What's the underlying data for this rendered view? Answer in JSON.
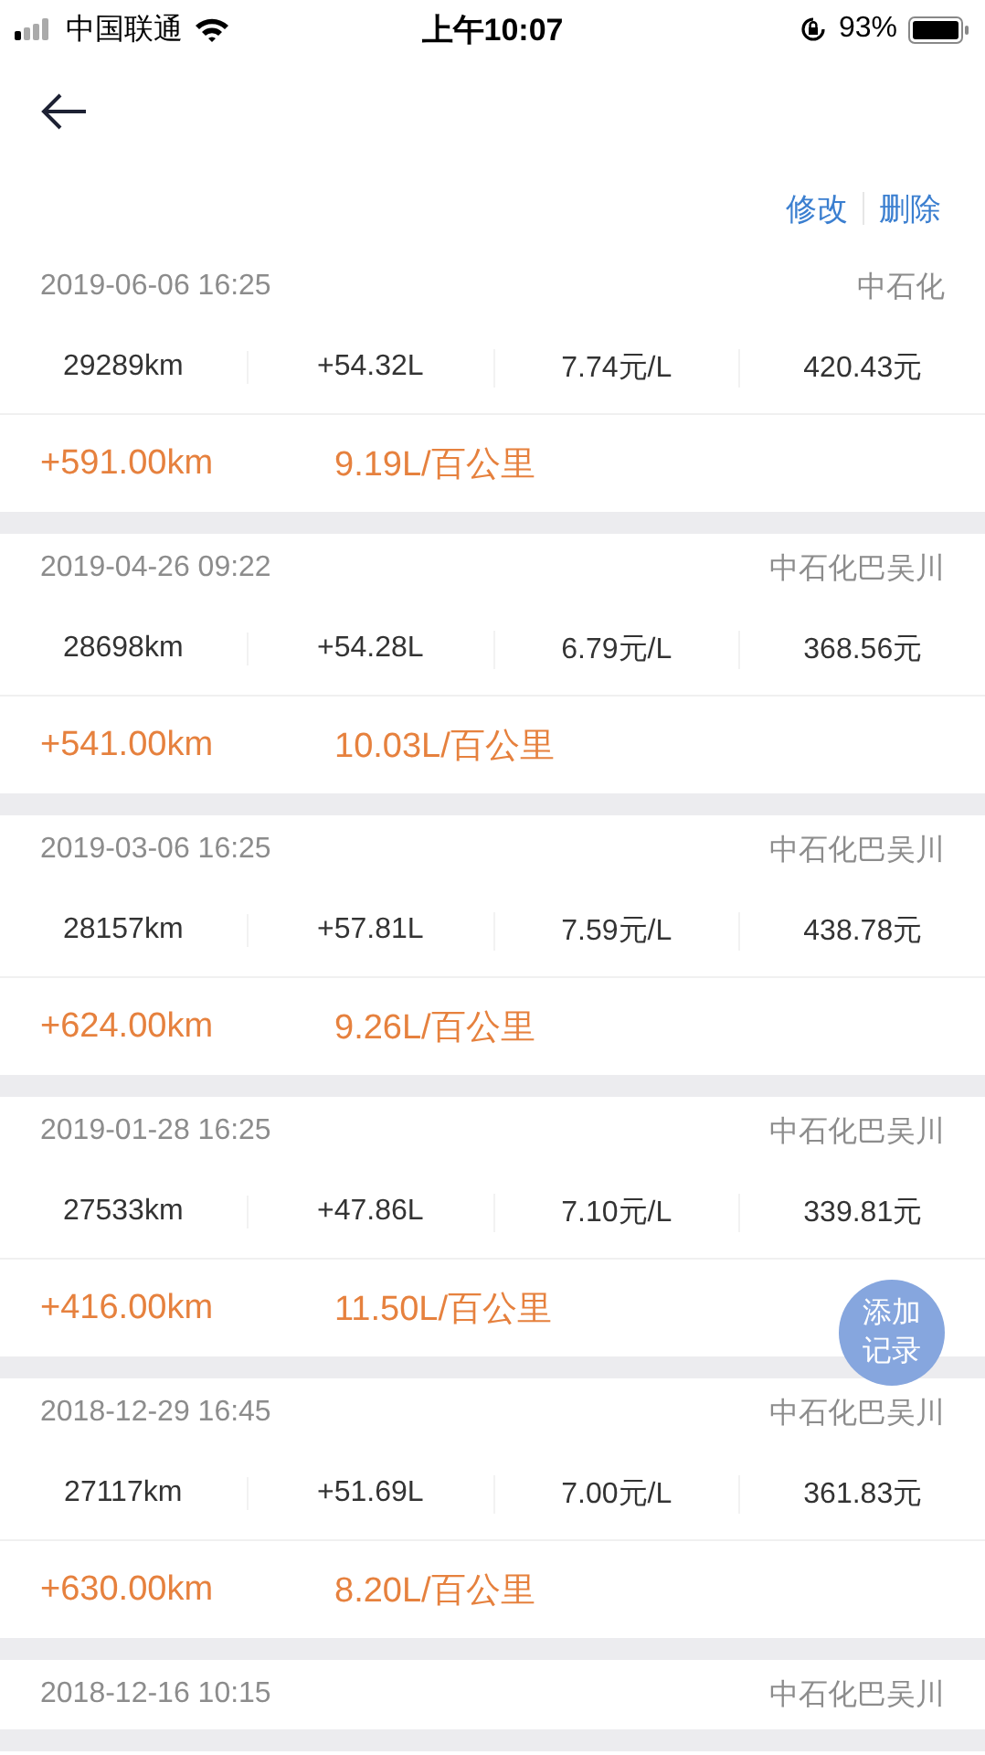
{
  "status_bar": {
    "carrier": "中国联通",
    "time": "上午10:07",
    "battery": "93%"
  },
  "actions": [
    "修改",
    "删除"
  ],
  "records": [
    {
      "date": "2019-06-06 16:25",
      "station": "中石化",
      "values": [
        "29289km",
        "+54.32L",
        "7.74元/L",
        "420.43元"
      ],
      "distance": "+591.00km",
      "consumption": "9.19L/百公里"
    },
    {
      "date": "2019-04-26 09:22",
      "station": "中石化巴吴川",
      "values": [
        "28698km",
        "+54.28L",
        "6.79元/L",
        "368.56元"
      ],
      "distance": "+541.00km",
      "consumption": "10.03L/百公里"
    },
    {
      "date": "2019-03-06 16:25",
      "station": "中石化巴吴川",
      "values": [
        "28157km",
        "+57.81L",
        "7.59元/L",
        "438.78元"
      ],
      "distance": "+624.00km",
      "consumption": "9.26L/百公里"
    },
    {
      "date": "2019-01-28 16:25",
      "station": "中石化巴吴川",
      "values": [
        "27533km",
        "+47.86L",
        "7.10元/L",
        "339.81元"
      ],
      "distance": "+416.00km",
      "consumption": "11.50L/百公里"
    },
    {
      "date": "2018-12-29 16:45",
      "station": "中石化巴吴川",
      "values": [
        "27117km",
        "+51.69L",
        "7.00元/L",
        "361.83元"
      ],
      "distance": "+630.00km",
      "consumption": "8.20L/百公里"
    },
    {
      "date": "2018-12-16 10:15",
      "station": "中石化巴吴川"
    }
  ],
  "add_button": [
    "添加",
    "记录"
  ]
}
